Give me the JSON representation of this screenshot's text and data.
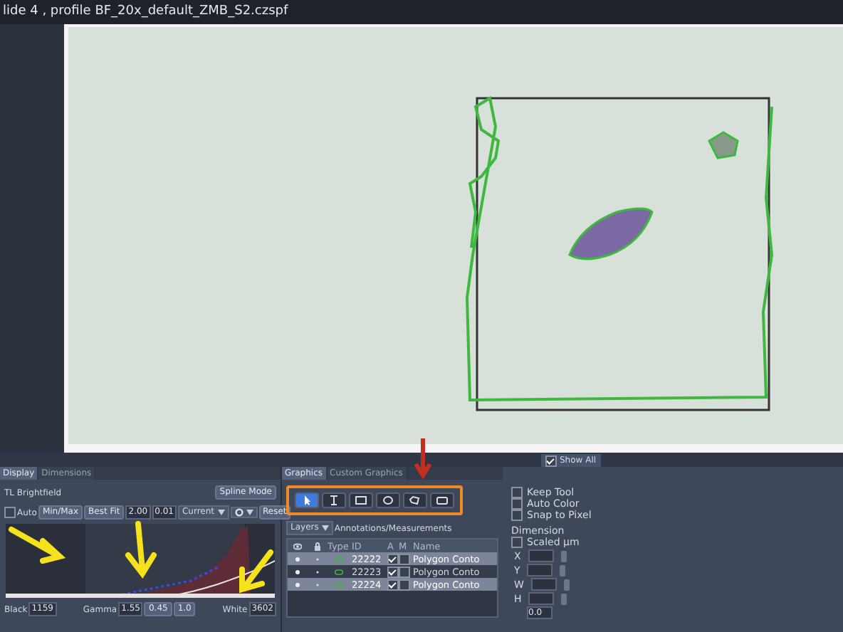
{
  "window": {
    "title": "lide 4 , profile BF_20x_default_ZMB_S2.czspf"
  },
  "image_view": {
    "show_all": {
      "label": "Show All",
      "checked": true
    }
  },
  "display_panel": {
    "tabs": [
      {
        "label": "Display",
        "selected": true
      },
      {
        "label": "Dimensions",
        "selected": false
      }
    ],
    "channel": "TL Brightfield",
    "spline_button": "Spline Mode",
    "auto": {
      "label": "Auto",
      "checked": false
    },
    "buttons": [
      "Min/Max",
      "Best Fit"
    ],
    "fields": [
      "2.00",
      "0.01"
    ],
    "mode_dropdown": "Current",
    "reset_button": "Reset",
    "black": {
      "label": "Black",
      "value": "1159"
    },
    "gamma": {
      "label": "Gamma",
      "value": "1.55"
    },
    "presets": [
      "0.45",
      "1.0"
    ],
    "white": {
      "label": "White",
      "value": "3602"
    }
  },
  "graphics_panel": {
    "tabs": [
      {
        "label": "Graphics",
        "selected": true
      },
      {
        "label": "Custom Graphics",
        "selected": false
      }
    ],
    "tools": [
      {
        "kind": "pointer",
        "selected": true
      },
      {
        "kind": "text",
        "selected": false
      },
      {
        "kind": "rectangle",
        "selected": false
      },
      {
        "kind": "ellipse",
        "selected": false
      },
      {
        "kind": "contour",
        "selected": false
      },
      {
        "kind": "frame",
        "selected": false
      }
    ],
    "layers_button": "Layers",
    "section_title": "Annotations/Measurements",
    "columns": [
      {
        "kind": "eye"
      },
      {
        "kind": "lock"
      },
      {
        "kind": "text",
        "label": "Type"
      },
      {
        "kind": "text",
        "label": "ID"
      },
      {
        "kind": "text",
        "label": "A"
      },
      {
        "kind": "text",
        "label": "M"
      },
      {
        "kind": "text",
        "label": "Name"
      }
    ],
    "rows": [
      {
        "id": "22222",
        "a": true,
        "m": false,
        "name": "Polygon Conto",
        "selected": true
      },
      {
        "id": "22223",
        "a": true,
        "m": false,
        "name": "Polygon Conto",
        "selected": false
      },
      {
        "id": "22224",
        "a": true,
        "m": false,
        "name": "Polygon Conto",
        "selected": true
      }
    ]
  },
  "options_panel": {
    "options": [
      {
        "label": "Keep Tool",
        "checked": false
      },
      {
        "label": "Auto Color",
        "checked": false
      },
      {
        "label": "Snap to Pixel",
        "checked": false
      }
    ],
    "dimension_title": "Dimension",
    "scaled": {
      "label": "Scaled µm",
      "checked": false
    },
    "dimension_fields": [
      {
        "label": "X"
      },
      {
        "label": "Y"
      },
      {
        "label": "W"
      },
      {
        "label": "H"
      }
    ],
    "angle_value": "0.0"
  }
}
